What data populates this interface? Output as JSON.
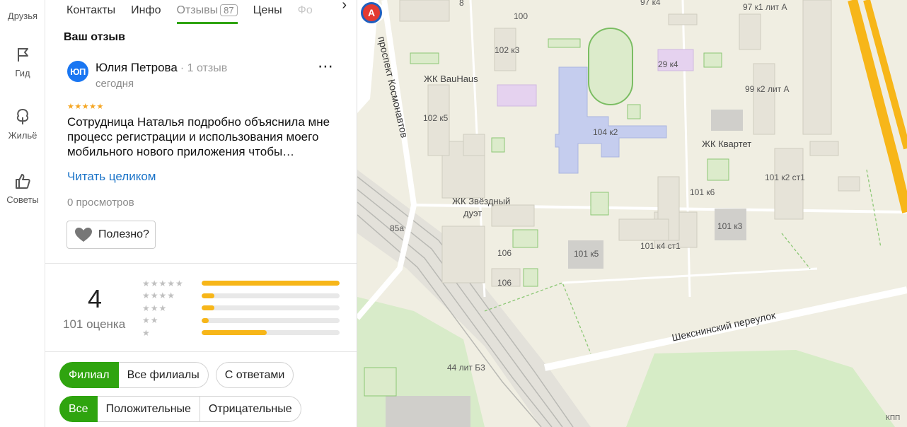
{
  "rail": {
    "items": [
      {
        "label": "Друзья"
      },
      {
        "label": "Гид"
      },
      {
        "label": "Жильё"
      },
      {
        "label": "Советы"
      }
    ]
  },
  "tabs": {
    "items": [
      "Контакты",
      "Инфо",
      "Отзывы",
      "Цены",
      "Фо"
    ],
    "reviews_count": "87",
    "active": "Отзывы"
  },
  "my_review": {
    "title": "Ваш отзыв"
  },
  "review": {
    "avatar_initials": "ЮП",
    "author": "Юлия Петрова",
    "author_meta": "· 1 отзыв",
    "date": "сегодня",
    "stars": "★★★★★",
    "text": "Сотрудница Наталья подробно объяснила мне процесс регистрации и использования моего мобильного нового приложения чтобы…",
    "read_more": "Читать целиком",
    "views": "0 просмотров",
    "useful": "Полезно?",
    "more_icon": "⋯"
  },
  "rating": {
    "value": "4",
    "count_label": "101 оценка",
    "distribution": [
      {
        "stars": "★★★★★",
        "share": 1.0
      },
      {
        "stars": "★★★★",
        "share": 0.09
      },
      {
        "stars": "★★★",
        "share": 0.09
      },
      {
        "stars": "★★",
        "share": 0.05
      },
      {
        "stars": "★",
        "share": 0.47
      }
    ]
  },
  "filters": {
    "branch": [
      "Филиал",
      "Все филиалы"
    ],
    "with_answers": "С ответами",
    "sentiment": [
      "Все",
      "Положительные",
      "Отрицательные"
    ]
  },
  "map": {
    "labels": [
      "8",
      "97 к4",
      "97 к1 лит А",
      "100",
      "102 к3",
      "ЖК BauHaus",
      "29 к4",
      "99 к2 лит А",
      "102 к5",
      "104 к2",
      "ЖК Квартет",
      "101 к2 ст1",
      "ЖК Звёздный",
      "дуэт",
      "101 к6",
      "101 к3",
      "85а",
      "106",
      "101 к5",
      "101 к4 ст1",
      "106",
      "44 лит Б3",
      "КПП"
    ],
    "streets": [
      "проспект Космонавтов",
      "Шекснинский переулок"
    ],
    "pin_letter": "A",
    "colors": {
      "road_major": "#f7b619",
      "pin": "#e33a32",
      "building_blue": "#c5cdee",
      "building_purple": "#e5d2ef"
    }
  }
}
